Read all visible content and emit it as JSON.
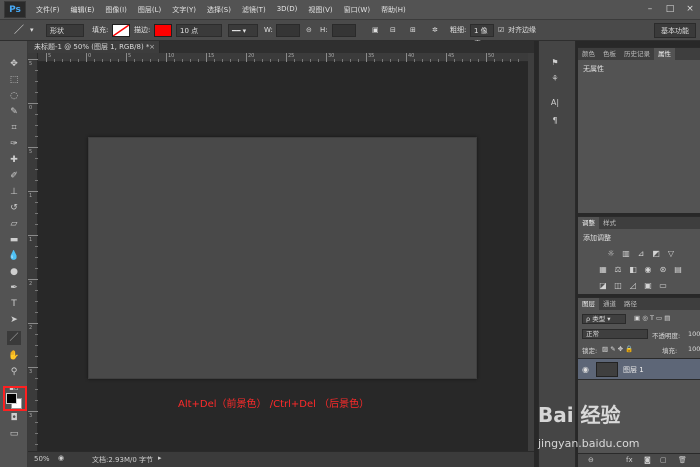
{
  "app": {
    "logo": "Ps"
  },
  "menu": [
    "文件(F)",
    "编辑(E)",
    "图像(I)",
    "图层(L)",
    "文字(Y)",
    "选择(S)",
    "滤镜(T)",
    "3D(D)",
    "视图(V)",
    "窗口(W)",
    "帮助(H)"
  ],
  "window_controls": [
    "–",
    "□",
    "×"
  ],
  "options_bar": {
    "mode": "形状",
    "fill_label": "填充:",
    "stroke_label": "描边:",
    "stroke_size": "10 点",
    "w_label": "W:",
    "h_label": "H:",
    "weight_label": "粗细:",
    "weight_value": "1 像素",
    "align_edges": "对齐边缘",
    "workspace": "基本功能",
    "stroke_color": "#ff0000"
  },
  "document": {
    "tab_title": "未标题-1 @ 50% (图层 1, RGB/8) *",
    "zoom": "50%",
    "doc_info": "文档:2.93M/0 字节",
    "ruler_h_labels": [
      "5",
      "0",
      "5",
      "10",
      "15",
      "20",
      "25",
      "30",
      "35",
      "40",
      "45",
      "50"
    ],
    "ruler_v_labels": [
      "5",
      "0",
      "5",
      "1",
      "1",
      "2",
      "2",
      "3",
      "3"
    ],
    "hint": "Alt+Del（前景色） /Ctrl+Del （后景色）"
  },
  "panels": {
    "properties": {
      "tabs": [
        "颜色",
        "色板",
        "历史记录",
        "属性"
      ],
      "body": "无属性"
    },
    "adjustments": {
      "tabs": [
        "调整",
        "样式"
      ],
      "title": "添加调整"
    },
    "layers": {
      "tabs": [
        "图层",
        "通道",
        "路径"
      ],
      "filter": "类型",
      "blend_mode": "正常",
      "opacity_label": "不透明度:",
      "opacity_value": "100",
      "lock_label": "锁定:",
      "fill_label": "填充:",
      "fill_value": "100",
      "layer_name": "图层 1"
    }
  },
  "watermark": {
    "logo": "Bai 经验",
    "url": "jingyan.baidu.com"
  }
}
